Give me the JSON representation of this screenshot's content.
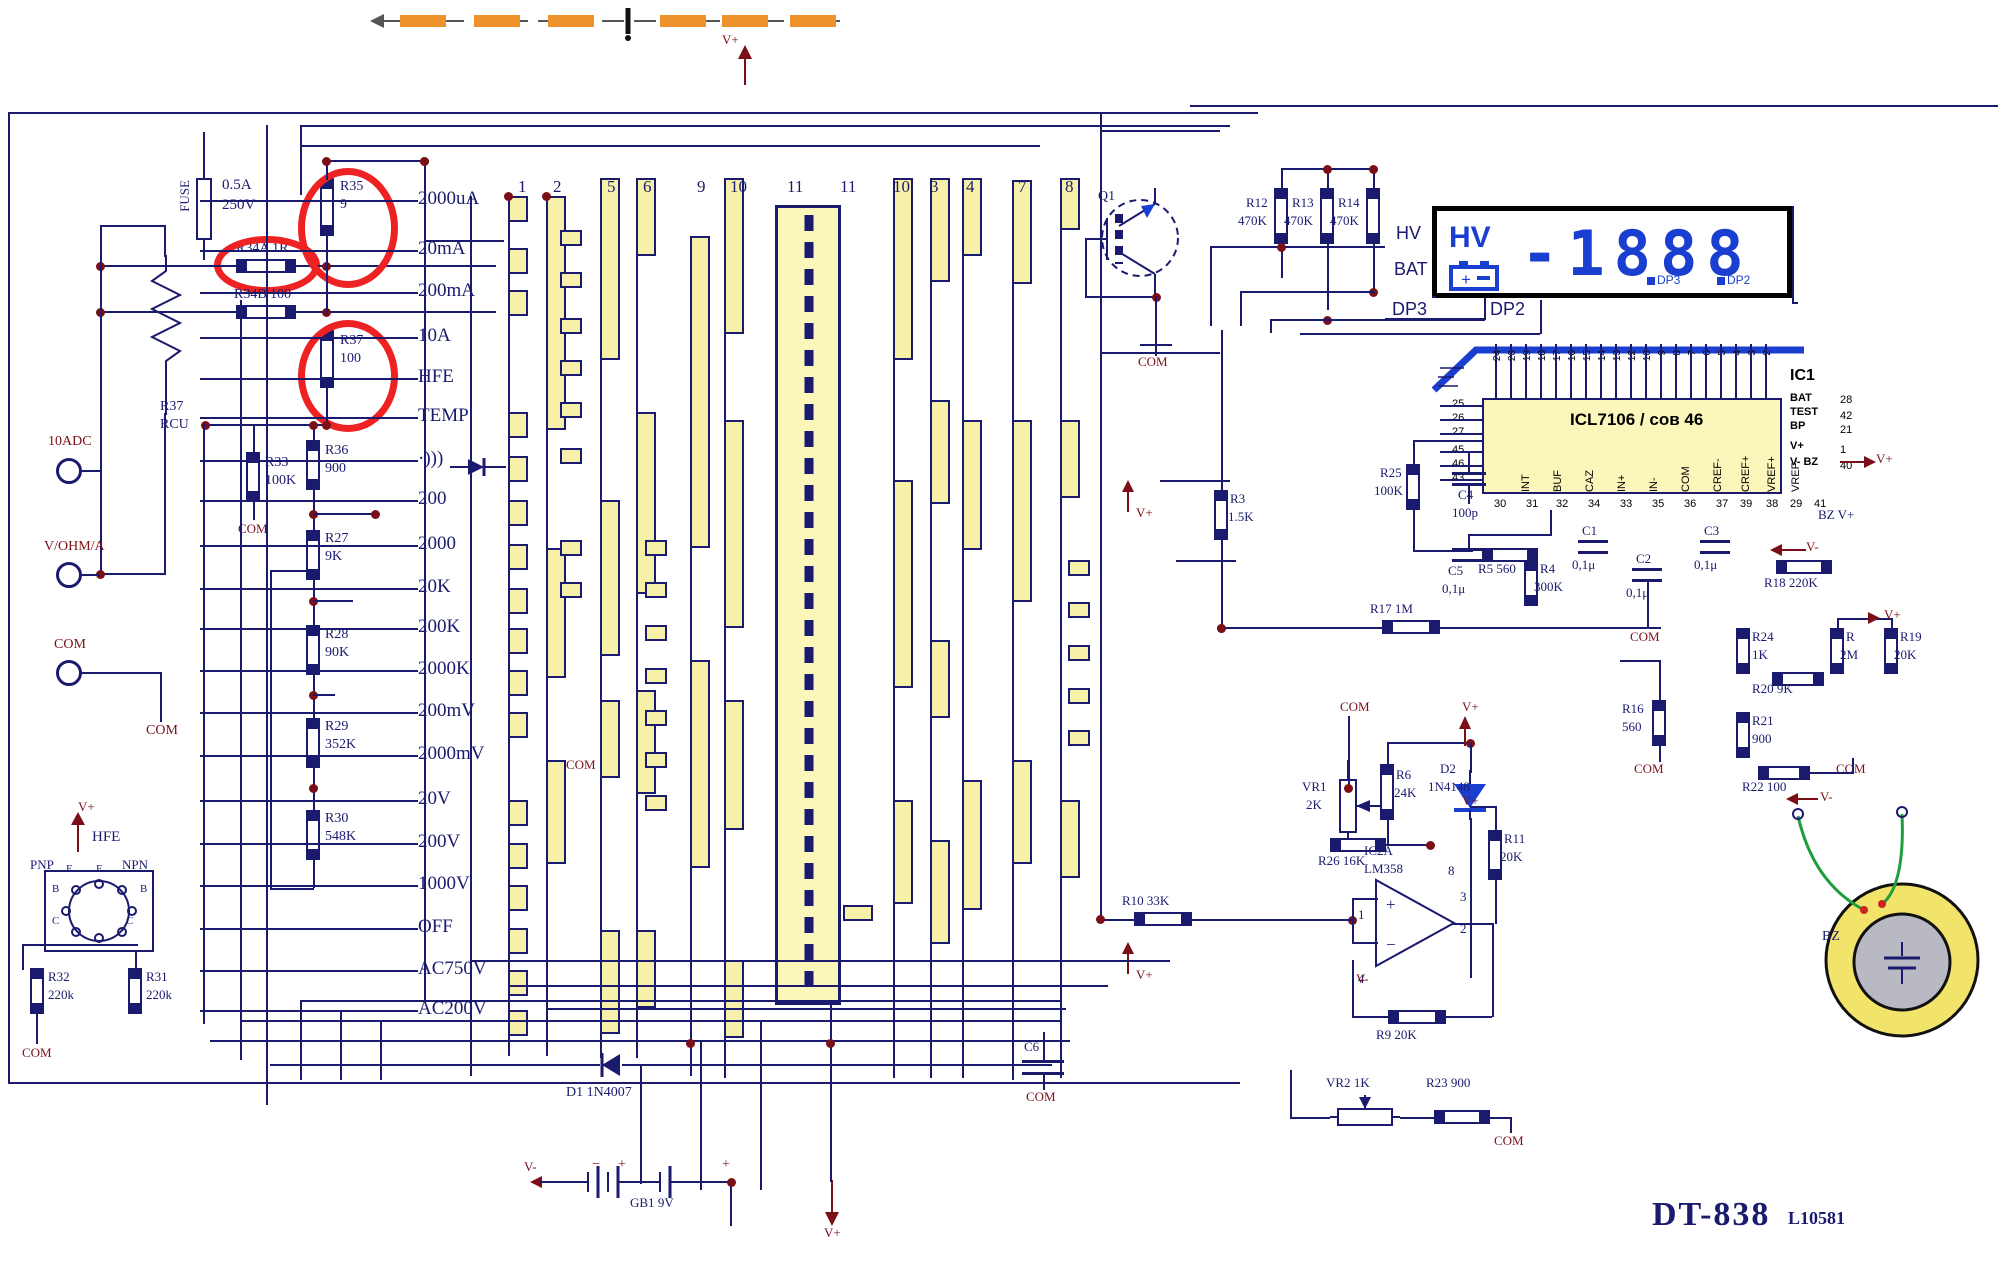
{
  "doc": {
    "title": "DT-838",
    "code": "L10581",
    "kind": "multimeter-schematic"
  },
  "top_strip": {
    "arrow": "←",
    "segments": 7
  },
  "mode_labels": [
    "2000uA",
    "20mA",
    "200mA",
    "10A",
    "HFE",
    "TEMP",
    "·)))",
    "200",
    "2000",
    "20K",
    "200K",
    "2000K",
    "200mV",
    "2000mV",
    "20V",
    "200V",
    "1000V",
    "OFF",
    "AC750V",
    "AC200V"
  ],
  "switch_columns": [
    "1",
    "2",
    "5",
    "6",
    "9",
    "10",
    "11",
    "11",
    "10",
    "3",
    "4",
    "7",
    "8"
  ],
  "input_jacks": [
    {
      "label": "10ADC"
    },
    {
      "label": "V/OHM/A"
    },
    {
      "label": "COM"
    }
  ],
  "fuse": {
    "ref": "FUSE",
    "value": "0.5A\n250V",
    "line1": "0.5A",
    "line2": "250V"
  },
  "resistors": [
    {
      "ref": "R34A",
      "value": "1R",
      "text": "R34A 1R",
      "highlight": true
    },
    {
      "ref": "R34B",
      "value": "100",
      "text": "R34B 100",
      "highlight": false
    },
    {
      "ref": "R35",
      "value": "9",
      "text": "R35",
      "val2": "9",
      "highlight": true
    },
    {
      "ref": "R37",
      "value": "100",
      "text": "R37",
      "val2": "100",
      "highlight": true
    },
    {
      "ref": "R37",
      "value": "RCU",
      "text": "R37",
      "val2": "RCU",
      "highlight": false
    },
    {
      "ref": "R33",
      "value": "100K",
      "text": "R33",
      "val2": "100K"
    },
    {
      "ref": "R36",
      "value": "900",
      "text": "R36",
      "val2": "900"
    },
    {
      "ref": "R27",
      "value": "9K",
      "text": "R27",
      "val2": "9K"
    },
    {
      "ref": "R28",
      "value": "90K",
      "text": "R28",
      "val2": "90K"
    },
    {
      "ref": "R29",
      "value": "352K",
      "text": "R29",
      "val2": "352K"
    },
    {
      "ref": "R30",
      "value": "548K",
      "text": "R30",
      "val2": "548K"
    },
    {
      "ref": "R32",
      "value": "220k",
      "text": "R32",
      "val2": "220k"
    },
    {
      "ref": "R31",
      "value": "220k",
      "text": "R31",
      "val2": "220k"
    },
    {
      "ref": "R3",
      "value": "1.5K",
      "text": "R3",
      "val2": "1.5K"
    },
    {
      "ref": "R12",
      "value": "470K",
      "text": "R12",
      "val2": "470K"
    },
    {
      "ref": "R13",
      "value": "470K",
      "text": "R13",
      "val2": "470K"
    },
    {
      "ref": "R14",
      "value": "470K",
      "text": "R14",
      "val2": "470K"
    },
    {
      "ref": "R25",
      "value": "100K",
      "text": "R25",
      "val2": "100K"
    },
    {
      "ref": "R5",
      "value": "560",
      "text": "R5 560"
    },
    {
      "ref": "R4",
      "value": "300K",
      "text": "R4",
      "val2": "300K"
    },
    {
      "ref": "R17",
      "value": "1M",
      "text": "R17 1M"
    },
    {
      "ref": "R16",
      "value": "560",
      "text": "R16",
      "val2": "560"
    },
    {
      "ref": "R18",
      "value": "220K",
      "text": "R18 220K"
    },
    {
      "ref": "R24",
      "value": "1K",
      "text": "R24",
      "val2": "1K"
    },
    {
      "ref": "R20",
      "value": "9K",
      "text": "R20 9K"
    },
    {
      "ref": "R21",
      "value": "900",
      "text": "R21",
      "val2": "900"
    },
    {
      "ref": "R22",
      "value": "100",
      "text": "R22 100"
    },
    {
      "ref": "R",
      "value": "2M",
      "text": "R",
      "val2": "2M"
    },
    {
      "ref": "R19",
      "value": "20K",
      "text": "R19",
      "val2": "20K"
    },
    {
      "ref": "R6",
      "value": "24K",
      "text": "R6",
      "val2": "24K"
    },
    {
      "ref": "R26",
      "value": "16K",
      "text": "R26 16K"
    },
    {
      "ref": "R11",
      "value": "20K",
      "text": "R11",
      "val2": "20K"
    },
    {
      "ref": "R10",
      "value": "33K",
      "text": "R10 33K"
    },
    {
      "ref": "R9",
      "value": "20K",
      "text": "R9 20K"
    },
    {
      "ref": "R23",
      "value": "900",
      "text": "R23 900"
    }
  ],
  "capacitors": [
    {
      "ref": "C4",
      "value": "100p"
    },
    {
      "ref": "C1",
      "value": "0,1μ"
    },
    {
      "ref": "C2",
      "value": "0,1μ"
    },
    {
      "ref": "C3",
      "value": "0,1μ"
    },
    {
      "ref": "C5",
      "value": "0,1μ"
    },
    {
      "ref": "C6",
      "value": ""
    }
  ],
  "pots": [
    {
      "ref": "VR1",
      "value": "2K"
    },
    {
      "ref": "VR2",
      "value": "1K"
    }
  ],
  "semis": [
    {
      "ref": "Q1",
      "value": ""
    },
    {
      "ref": "D1",
      "value": "1N4007"
    },
    {
      "ref": "D2",
      "value": "1N4148"
    },
    {
      "ref": "IC2A",
      "value": "LM358"
    }
  ],
  "ic1": {
    "ref": "IC1",
    "name": "ICL7106 / сов 46",
    "pin_names": [
      "INT",
      "BUF",
      "CAZ",
      "IN+",
      "IN-",
      "COM",
      "CREF-",
      "CREF+",
      "VREF+",
      "VREF-"
    ],
    "left_pins": [
      "25",
      "26",
      "27",
      "45",
      "46",
      "43"
    ],
    "right_pins": [
      "28",
      "42",
      "21",
      "1",
      "40"
    ],
    "right_names": [
      "BAT",
      "TEST",
      "BP",
      "V+",
      "V- BZ"
    ],
    "bottom_pins": [
      "30",
      "31",
      "32",
      "34",
      "33",
      "35",
      "36",
      "37",
      "39",
      "38",
      "29",
      "41"
    ],
    "top_pins": [
      "24",
      "20",
      "19",
      "18",
      "17",
      "16",
      "15",
      "14",
      "13",
      "12",
      "10",
      "9",
      "8",
      "7",
      "6",
      "5",
      "4",
      "3",
      "2"
    ]
  },
  "lcd": {
    "hv": "HV",
    "bat_icon": "battery-icon",
    "digits": "-1888",
    "dp_labels": [
      "DP3",
      "DP2"
    ],
    "left_pins": [
      "HV",
      "BAT",
      "DP3"
    ],
    "dp2": "DP2"
  },
  "hfe": {
    "title": "HFE",
    "pnp": "PNP",
    "npn": "NPN",
    "pins": [
      "E",
      "B",
      "C",
      "E",
      "E",
      "B",
      "C",
      "E"
    ],
    "vplus": "V+"
  },
  "battery": {
    "ref": "GB1",
    "value": "9V",
    "minus": "V-",
    "plus": "V+"
  },
  "buzzer": {
    "ref": "BZ",
    "vminus": "V-"
  },
  "nets": {
    "vplus": "V+",
    "vminus": "V-",
    "com": "COM",
    "bzvplus": "BZ V+"
  },
  "opamp": {
    "ref": "IC2A",
    "part": "LM358",
    "pins": [
      "8",
      "3",
      "2",
      "1",
      "4"
    ]
  }
}
